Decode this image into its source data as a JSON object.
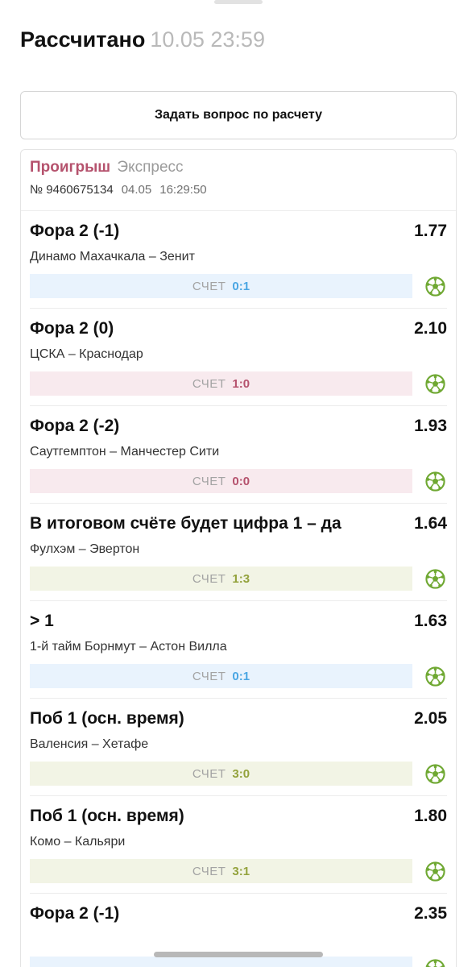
{
  "header": {
    "title": "Рассчитано",
    "date": "10.05 23:59"
  },
  "ask_button": {
    "label": "Задать вопрос по расчету"
  },
  "bet": {
    "status": "Проигрыш",
    "type": "Экспресс",
    "number": "№ 9460675134",
    "date": "04.05",
    "time": "16:29:50"
  },
  "colors": {
    "loss": "#b5526d",
    "blue_score": "#4aa6e3",
    "pink_score": "#b5526d",
    "olive_score": "#93a23c",
    "ball_icon": "#6fa832"
  },
  "events": [
    {
      "market": "Фора 2 (-1)",
      "odd": "1.77",
      "teams": "Динамо Махачкала – Зенит",
      "score_label": "СЧЕТ",
      "score": "0:1",
      "tone": "blue",
      "icon": "football-icon"
    },
    {
      "market": "Фора 2 (0)",
      "odd": "2.10",
      "teams": "ЦСКА – Краснодар",
      "score_label": "СЧЕТ",
      "score": "1:0",
      "tone": "pink",
      "icon": "football-icon"
    },
    {
      "market": "Фора 2 (-2)",
      "odd": "1.93",
      "teams": "Саутгемптон – Манчестер Сити",
      "score_label": "СЧЕТ",
      "score": "0:0",
      "tone": "pink",
      "icon": "football-icon"
    },
    {
      "market": "В итоговом счёте будет цифра 1 – да",
      "odd": "1.64",
      "teams": "Фулхэм – Эвертон",
      "score_label": "СЧЕТ",
      "score": "1:3",
      "tone": "olive",
      "icon": "football-icon"
    },
    {
      "market": "> 1",
      "odd": "1.63",
      "teams": "1-й тайм Борнмут – Астон Вилла",
      "score_label": "СЧЕТ",
      "score": "0:1",
      "tone": "blue",
      "icon": "football-icon"
    },
    {
      "market": "Поб 1 (осн. время)",
      "odd": "2.05",
      "teams": "Валенсия – Хетафе",
      "score_label": "СЧЕТ",
      "score": "3:0",
      "tone": "olive",
      "icon": "football-icon"
    },
    {
      "market": "Поб 1 (осн. время)",
      "odd": "1.80",
      "teams": "Комо – Кальяри",
      "score_label": "СЧЕТ",
      "score": "3:1",
      "tone": "olive",
      "icon": "football-icon"
    },
    {
      "market": "Фора 2 (-1)",
      "odd": "2.35",
      "teams": "",
      "score_label": "",
      "score": "",
      "tone": "blue",
      "icon": "football-icon"
    }
  ]
}
